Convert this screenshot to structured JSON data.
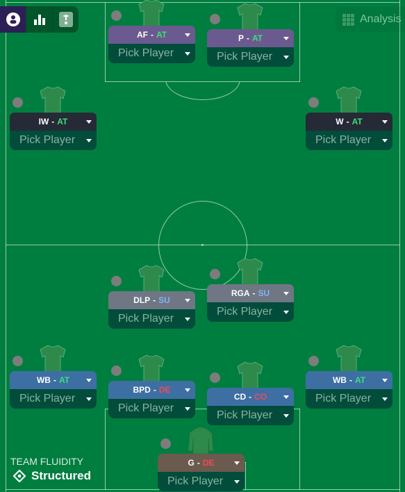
{
  "toolbar": {
    "buttons": [
      {
        "icon": "player-profile-icon",
        "active": true
      },
      {
        "icon": "bar-chart-icon",
        "active": false
      },
      {
        "icon": "instruction-icon",
        "active": false
      }
    ]
  },
  "analysis": {
    "label": "Analysis",
    "icon": "grid-icon"
  },
  "colors": {
    "attack_role": "#6b5a8f",
    "winger_role": "#262a36",
    "midfield_role": "#6f7684",
    "defence_role": "#3e6fa3",
    "goalkeeper_role": "#6b5a4e",
    "pick_bg": "#014c3a",
    "pitch": "#007e40"
  },
  "positions": [
    {
      "id": "af",
      "role": "AF",
      "duty": "AT",
      "player": "Pick Player"
    },
    {
      "id": "p",
      "role": "P",
      "duty": "AT",
      "player": "Pick Player"
    },
    {
      "id": "iw",
      "role": "IW",
      "duty": "AT",
      "player": "Pick Player"
    },
    {
      "id": "w",
      "role": "W",
      "duty": "AT",
      "player": "Pick Player"
    },
    {
      "id": "dlp",
      "role": "DLP",
      "duty": "SU",
      "player": "Pick Player"
    },
    {
      "id": "rga",
      "role": "RGA",
      "duty": "SU",
      "player": "Pick Player"
    },
    {
      "id": "wbl",
      "role": "WB",
      "duty": "AT",
      "player": "Pick Player"
    },
    {
      "id": "bpd",
      "role": "BPD",
      "duty": "DE",
      "player": "Pick Player"
    },
    {
      "id": "cd",
      "role": "CD",
      "duty": "CO",
      "player": "Pick Player"
    },
    {
      "id": "wbr",
      "role": "WB",
      "duty": "AT",
      "player": "Pick Player"
    },
    {
      "id": "g",
      "role": "G",
      "duty": "DE",
      "player": "Pick Player"
    }
  ],
  "separator": "-",
  "team_fluidity": {
    "label": "TEAM FLUIDITY",
    "value": "Structured"
  }
}
